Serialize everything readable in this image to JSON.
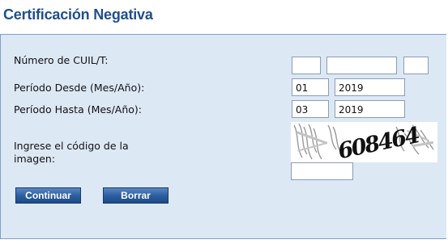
{
  "page": {
    "title": "Certificación Negativa"
  },
  "form": {
    "cuil_label": "Número de CUIL/T:",
    "cuil_part1": "",
    "cuil_part2": "",
    "cuil_part3": "",
    "desde_label": "Período Desde (Mes/Año):",
    "desde_mes": "01",
    "desde_anio": "2019",
    "hasta_label": "Período Hasta (Mes/Año):",
    "hasta_mes": "03",
    "hasta_anio": "2019",
    "captcha_label": "Ingrese el código de la imagen:",
    "captcha_text": "608464",
    "captcha_input": ""
  },
  "buttons": {
    "continuar": "Continuar",
    "borrar": "Borrar"
  },
  "colors": {
    "title": "#1f4f8b",
    "panel_bg": "#dde8f5",
    "button_bg": "#2d5f9f"
  }
}
